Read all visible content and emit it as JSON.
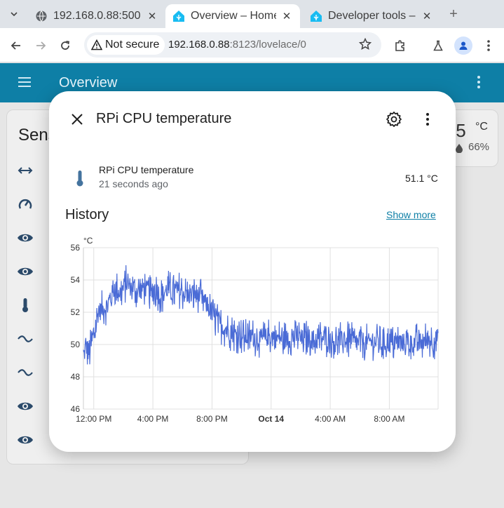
{
  "browser": {
    "tabs": [
      {
        "title": "192.168.0.88:500",
        "active": false
      },
      {
        "title": "Overview – Home",
        "active": true
      },
      {
        "title": "Developer tools –",
        "active": false
      }
    ],
    "security_label": "Not secure",
    "url_host": "192.168.0.88",
    "url_rest": ":8123/lovelace/0"
  },
  "header": {
    "title": "Overview"
  },
  "background": {
    "card_heading": "Sens",
    "temp_value": ".5",
    "temp_unit": "°C",
    "humidity": "66%"
  },
  "dialog": {
    "title": "RPi CPU temperature",
    "entity_name": "RPi CPU temperature",
    "last_changed": "21 seconds ago",
    "state": "51.1 °C",
    "history_title": "History",
    "show_more": "Show more"
  },
  "colors": {
    "header": "#0e7fa6",
    "series": "#4a6bd6",
    "accent": "#0e7fa6"
  },
  "chart_data": {
    "type": "line",
    "ylabel": "°C",
    "ylim": [
      46,
      56
    ],
    "yticks": [
      46,
      48,
      50,
      52,
      54,
      56
    ],
    "x_tick_labels": [
      "12:00 PM",
      "4:00 PM",
      "8:00 PM",
      "Oct 14",
      "4:00 AM",
      "8:00 AM"
    ],
    "x_range_hours": [
      -0.7,
      23.3
    ],
    "series": [
      {
        "points": [
          [
            -0.7,
            49.3
          ],
          [
            -0.5,
            49.8
          ],
          [
            -0.3,
            49.5
          ],
          [
            -0.1,
            50.2
          ],
          [
            0.1,
            51.0
          ],
          [
            0.3,
            52.0
          ],
          [
            0.6,
            52.2
          ],
          [
            1.0,
            52.5
          ],
          [
            1.4,
            53.5
          ],
          [
            1.8,
            53.2
          ],
          [
            2.2,
            53.8
          ],
          [
            2.6,
            53.5
          ],
          [
            3.0,
            53.3
          ],
          [
            3.4,
            53.6
          ],
          [
            3.8,
            53.1
          ],
          [
            4.2,
            53.4
          ],
          [
            4.6,
            53.0
          ],
          [
            5.0,
            53.5
          ],
          [
            5.4,
            53.2
          ],
          [
            5.8,
            53.4
          ],
          [
            6.2,
            53.1
          ],
          [
            6.6,
            53.0
          ],
          [
            7.0,
            53.2
          ],
          [
            7.4,
            52.8
          ],
          [
            7.8,
            52.2
          ],
          [
            8.2,
            51.6
          ],
          [
            8.6,
            51.2
          ],
          [
            9.0,
            50.9
          ],
          [
            9.4,
            50.7
          ],
          [
            9.8,
            50.6
          ],
          [
            10.2,
            50.4
          ],
          [
            10.6,
            50.5
          ],
          [
            11.0,
            50.4
          ],
          [
            11.4,
            50.3
          ],
          [
            11.8,
            50.5
          ],
          [
            12.2,
            50.4
          ],
          [
            12.6,
            50.4
          ],
          [
            13.0,
            50.3
          ],
          [
            13.4,
            50.4
          ],
          [
            13.8,
            50.5
          ],
          [
            14.2,
            50.3
          ],
          [
            14.6,
            50.4
          ],
          [
            15.0,
            50.2
          ],
          [
            15.4,
            50.4
          ],
          [
            15.8,
            50.3
          ],
          [
            16.2,
            50.3
          ],
          [
            16.6,
            50.2
          ],
          [
            17.0,
            50.3
          ],
          [
            17.4,
            50.2
          ],
          [
            17.8,
            50.1
          ],
          [
            18.2,
            50.2
          ],
          [
            18.6,
            50.1
          ],
          [
            19.0,
            50.2
          ],
          [
            19.4,
            50.0
          ],
          [
            19.8,
            50.1
          ],
          [
            20.2,
            50.0
          ],
          [
            20.6,
            50.2
          ],
          [
            21.0,
            50.1
          ],
          [
            21.4,
            50.0
          ],
          [
            21.8,
            50.2
          ],
          [
            22.2,
            50.1
          ],
          [
            22.6,
            50.3
          ],
          [
            23.0,
            50.2
          ],
          [
            23.3,
            50.4
          ]
        ],
        "noise_amplitude": 1.2
      }
    ]
  }
}
